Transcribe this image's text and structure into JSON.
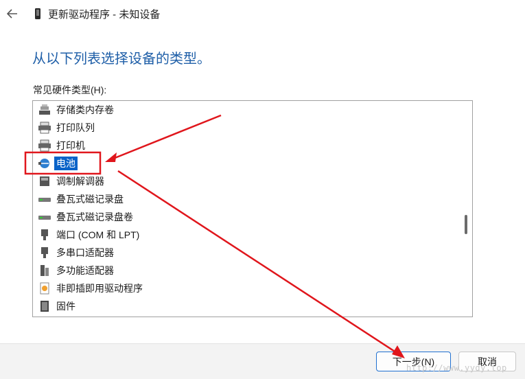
{
  "titlebar": {
    "title": "更新驱动程序 - 未知设备"
  },
  "heading": "从以下列表选择设备的类型。",
  "list": {
    "label": "常见硬件类型(H):",
    "items": [
      {
        "label": "存储类内存卷",
        "icon": "memory-icon"
      },
      {
        "label": "打印队列",
        "icon": "printer-icon"
      },
      {
        "label": "打印机",
        "icon": "printer-icon"
      },
      {
        "label": "电池",
        "icon": "battery-icon",
        "selected": true
      },
      {
        "label": "调制解调器",
        "icon": "modem-icon"
      },
      {
        "label": "叠瓦式磁记录盘",
        "icon": "disk-icon"
      },
      {
        "label": "叠瓦式磁记录盘卷",
        "icon": "disk-icon"
      },
      {
        "label": "端口 (COM 和 LPT)",
        "icon": "port-icon"
      },
      {
        "label": "多串口适配器",
        "icon": "port-icon"
      },
      {
        "label": "多功能适配器",
        "icon": "multifunction-icon"
      },
      {
        "label": "非即插即用驱动程序",
        "icon": "driver-icon"
      },
      {
        "label": "固件",
        "icon": "firmware-icon"
      }
    ]
  },
  "buttons": {
    "next": "下一步(N)",
    "cancel": "取消"
  },
  "watermark": "http://www.yydy.top",
  "colors": {
    "heading": "#1f5fa8",
    "selection": "#0a63c8",
    "annotation": "#e0161c"
  }
}
